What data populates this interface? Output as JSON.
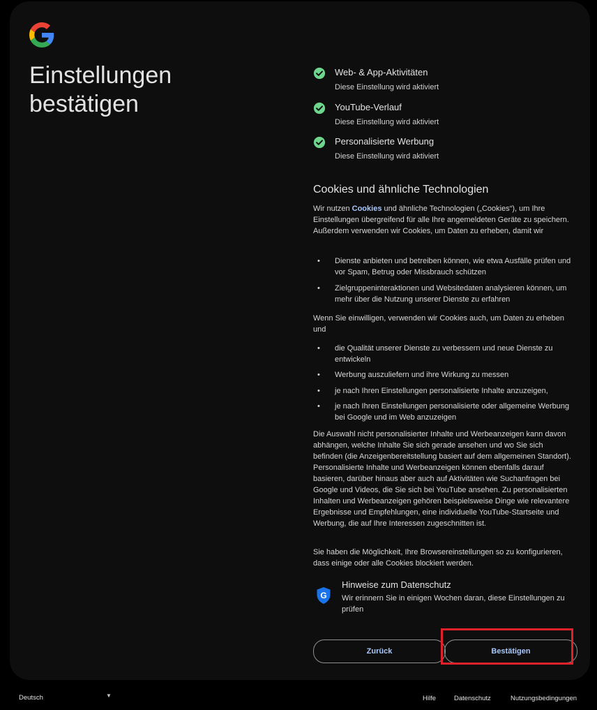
{
  "page": {
    "title": "Einstellungen bestätigen"
  },
  "settings": [
    {
      "title": "Web- & App-Aktivitäten",
      "subtitle": "Diese Einstellung wird aktiviert",
      "icon": "check-circle-icon"
    },
    {
      "title": "YouTube-Verlauf",
      "subtitle": "Diese Einstellung wird aktiviert",
      "icon": "check-circle-icon"
    },
    {
      "title": "Personalisierte Werbung",
      "subtitle": "Diese Einstellung wird aktiviert",
      "icon": "check-circle-icon"
    }
  ],
  "cookies": {
    "heading": "Cookies und ähnliche Technologien",
    "intro_before_link": "Wir nutzen ",
    "intro_link": "Cookies",
    "intro_after_link": " und ähnliche Technologien („Cookies“), um Ihre Einstellungen übergreifend für alle Ihre angemeldeten Geräte zu speichern. Außerdem verwenden wir Cookies, um Daten zu erheben, damit wir",
    "bullets_a": [
      "Dienste anbieten und betreiben können, wie etwa Ausfälle prüfen und vor Spam, Betrug oder Missbrauch schützen",
      "Zielgruppeninteraktionen und Websitedaten analysieren können, um mehr über die Nutzung unserer Dienste zu erfahren"
    ],
    "consent_intro": "Wenn Sie einwilligen, verwenden wir Cookies auch, um Daten zu erheben und",
    "bullets_b": [
      "die Qualität unserer Dienste zu verbessern und neue Dienste zu entwickeln",
      "Werbung auszuliefern und ihre Wirkung zu messen",
      "je nach Ihren Einstellungen personalisierte Inhalte anzuzeigen,",
      "je nach Ihren Einstellungen personalisierte oder allgemeine Werbung bei Google und im Web anzuzeigen"
    ],
    "paragraph_personalization": "Die Auswahl nicht personalisierter Inhalte und Werbeanzeigen kann davon abhängen, welche Inhalte Sie sich gerade ansehen und wo Sie sich befinden (die Anzeigenbereitstellung basiert auf dem allgemeinen Standort). Personalisierte Inhalte und Werbeanzeigen können ebenfalls darauf basieren, darüber hinaus aber auch auf Aktivitäten wie Suchanfragen bei Google und Videos, die Sie sich bei YouTube ansehen. Zu personalisierten Inhalten und Werbeanzeigen gehören beispielsweise Dinge wie relevantere Ergebnisse und Empfehlungen, eine individuelle YouTube-Startseite und Werbung, die auf Ihre Interessen zugeschnitten ist.",
    "paragraph_browser": "Sie haben die Möglichkeit, Ihre Browsereinstellungen so zu konfigurieren, dass einige oder alle Cookies blockiert werden."
  },
  "privacy_notice": {
    "title": "Hinweise zum Datenschutz",
    "text": "Wir erinnern Sie in einigen Wochen daran, diese Einstellungen zu prüfen",
    "icon": "google-shield-icon"
  },
  "buttons": {
    "back": "Zurück",
    "confirm": "Bestätigen"
  },
  "footer": {
    "language": "Deutsch",
    "help": "Hilfe",
    "privacy": "Datenschutz",
    "terms": "Nutzungsbedingungen"
  },
  "colors": {
    "background": "#000000",
    "card": "#0e0e0e",
    "check_green": "#6dd58c",
    "link_blue": "#a8c7fa",
    "highlight_red": "#e0202a",
    "shield_blue": "#1a73e8"
  }
}
